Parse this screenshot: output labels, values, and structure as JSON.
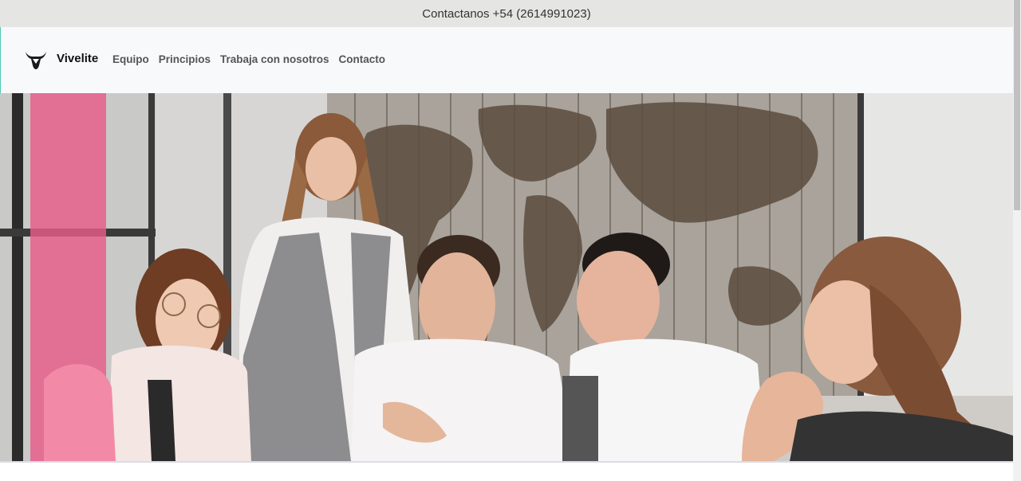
{
  "topbar": {
    "contact_text": "Contactanos +54 (2614991023)"
  },
  "navbar": {
    "brand_name": "Vivelite",
    "logo_icon": "bull-head-logo",
    "links": [
      {
        "label": "Equipo"
      },
      {
        "label": "Principios"
      },
      {
        "label": "Trabaja con nosotros"
      },
      {
        "label": "Contacto"
      }
    ]
  },
  "colors": {
    "topbar_bg": "#e5e5e3",
    "navbar_bg": "#f8f9fa",
    "accent_pink": "#f06b93",
    "nav_link": "#555555"
  }
}
